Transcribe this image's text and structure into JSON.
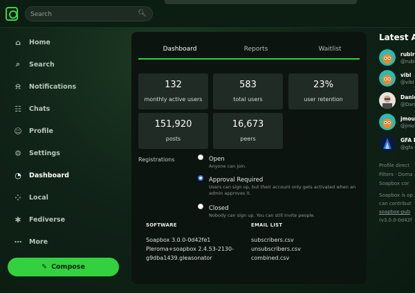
{
  "search": {
    "placeholder": "Search"
  },
  "nav": [
    {
      "label": "Home",
      "icon": "home-icon"
    },
    {
      "label": "Search",
      "icon": "search-icon"
    },
    {
      "label": "Notifications",
      "icon": "bell-icon"
    },
    {
      "label": "Chats",
      "icon": "chat-icon"
    },
    {
      "label": "Profile",
      "icon": "user-icon"
    },
    {
      "label": "Settings",
      "icon": "gear-icon"
    },
    {
      "label": "Dashboard",
      "icon": "dashboard-icon",
      "active": true
    },
    {
      "label": "Local",
      "icon": "local-icon"
    },
    {
      "label": "Fediverse",
      "icon": "fediverse-icon"
    },
    {
      "label": "More",
      "icon": "more-icon"
    }
  ],
  "compose": {
    "label": "Compose"
  },
  "tabs": [
    {
      "label": "Dashboard",
      "active": true
    },
    {
      "label": "Reports"
    },
    {
      "label": "Waitlist"
    }
  ],
  "stats": [
    {
      "value": "132",
      "label": "monthly active users"
    },
    {
      "value": "583",
      "label": "total users"
    },
    {
      "value": "23%",
      "label": "user retention"
    },
    {
      "value": "151,920",
      "label": "posts"
    },
    {
      "value": "16,673",
      "label": "peers"
    }
  ],
  "registrations": {
    "title": "Registrations",
    "options": [
      {
        "title": "Open",
        "desc": "Anyone can join.",
        "checked": false
      },
      {
        "title": "Approval Required",
        "desc": "Users can sign up, but their account only gets activated when an admin approves it.",
        "checked": true
      },
      {
        "title": "Closed",
        "desc": "Nobody can sign up. You can still invite people.",
        "checked": false
      }
    ]
  },
  "software": {
    "heading": "SOFTWARE",
    "lines": [
      "Soapbox 3.0.0-0d42fe1",
      "Pleroma+soapbox 2.4.53-2130-",
      "g9dba1439.gleasonator"
    ]
  },
  "email_list": {
    "heading": "EMAIL LIST",
    "links": [
      "subscribers.csv",
      "unsubscribers.csv",
      "combined.csv"
    ]
  },
  "latest": {
    "title": "Latest Ac",
    "accounts": [
      {
        "name": "rubir",
        "handle": "@rubi"
      },
      {
        "name": "vibl",
        "handle": "@vibl"
      },
      {
        "name": "Danie",
        "handle": "@Dan"
      },
      {
        "name": "jmou",
        "handle": "@jmo"
      },
      {
        "name": "GFA I",
        "handle": "@gfa"
      }
    ]
  },
  "footer": {
    "lines": [
      "Profile direct",
      "Filters · Doma",
      "Soapbox cor",
      "Soapbox is op",
      "can contribut"
    ],
    "link": "soapbox-pub",
    "version": "(v3.0.0-0d42f"
  },
  "colors": {
    "accent": "#33d13f",
    "panel": "#0b140e",
    "card": "#1f2b24",
    "radio_checked": "#3a6ef0"
  }
}
